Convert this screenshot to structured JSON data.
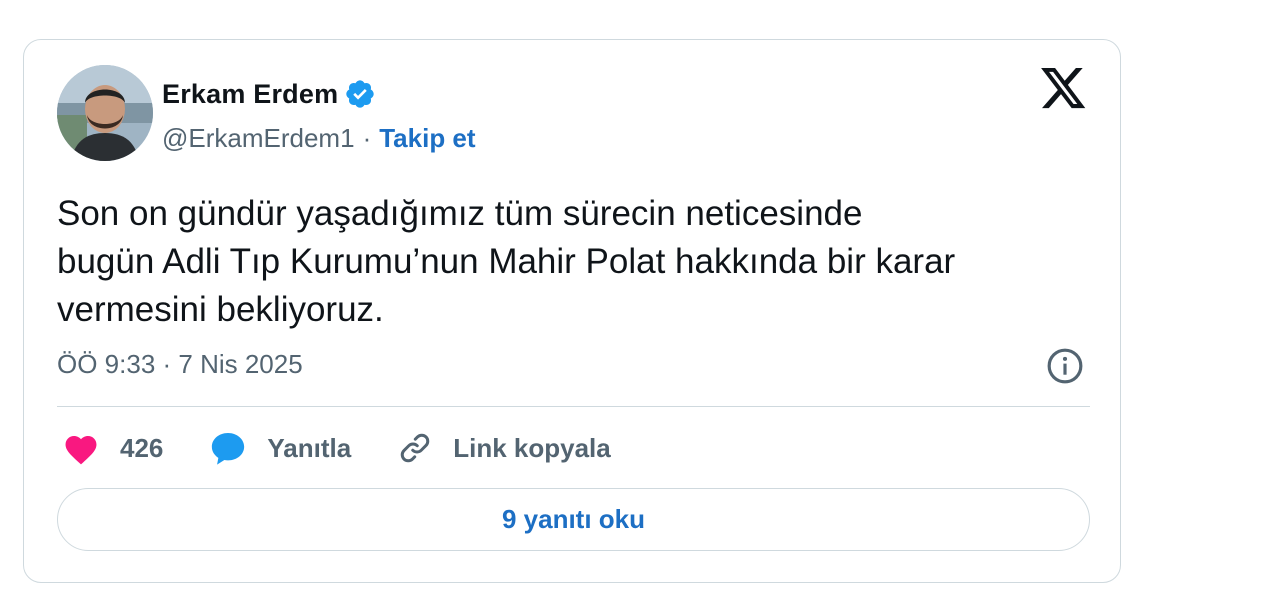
{
  "author": {
    "display_name": "Erkam Erdem",
    "handle": "@ErkamErdem1",
    "verified": true,
    "follow_label": "Takip et",
    "separator": "·"
  },
  "tweet": {
    "text": "Son on gündür yaşadığımız tüm sürecin neticesinde\nbugün Adli Tıp Kurumu’nun Mahir Polat hakkında bir karar\nvermesini bekliyoruz.",
    "timestamp": "ÖÖ 9:33 · 7 Nis 2025"
  },
  "actions": {
    "like_count": "426",
    "reply_label": "Yanıtla",
    "copy_link_label": "Link kopyala"
  },
  "footer": {
    "read_replies_label": "9 yanıtı oku"
  },
  "icons": {
    "brand": "x-logo-icon",
    "verified": "verified-badge-icon",
    "info": "info-icon",
    "like": "heart-icon",
    "reply": "speech-bubble-icon",
    "link": "link-icon"
  },
  "colors": {
    "link_blue": "#1d6fc4",
    "verified_blue": "#1d9bf0",
    "heart_pink": "#f91880",
    "muted_text": "#536471",
    "border": "#cfd9de"
  }
}
